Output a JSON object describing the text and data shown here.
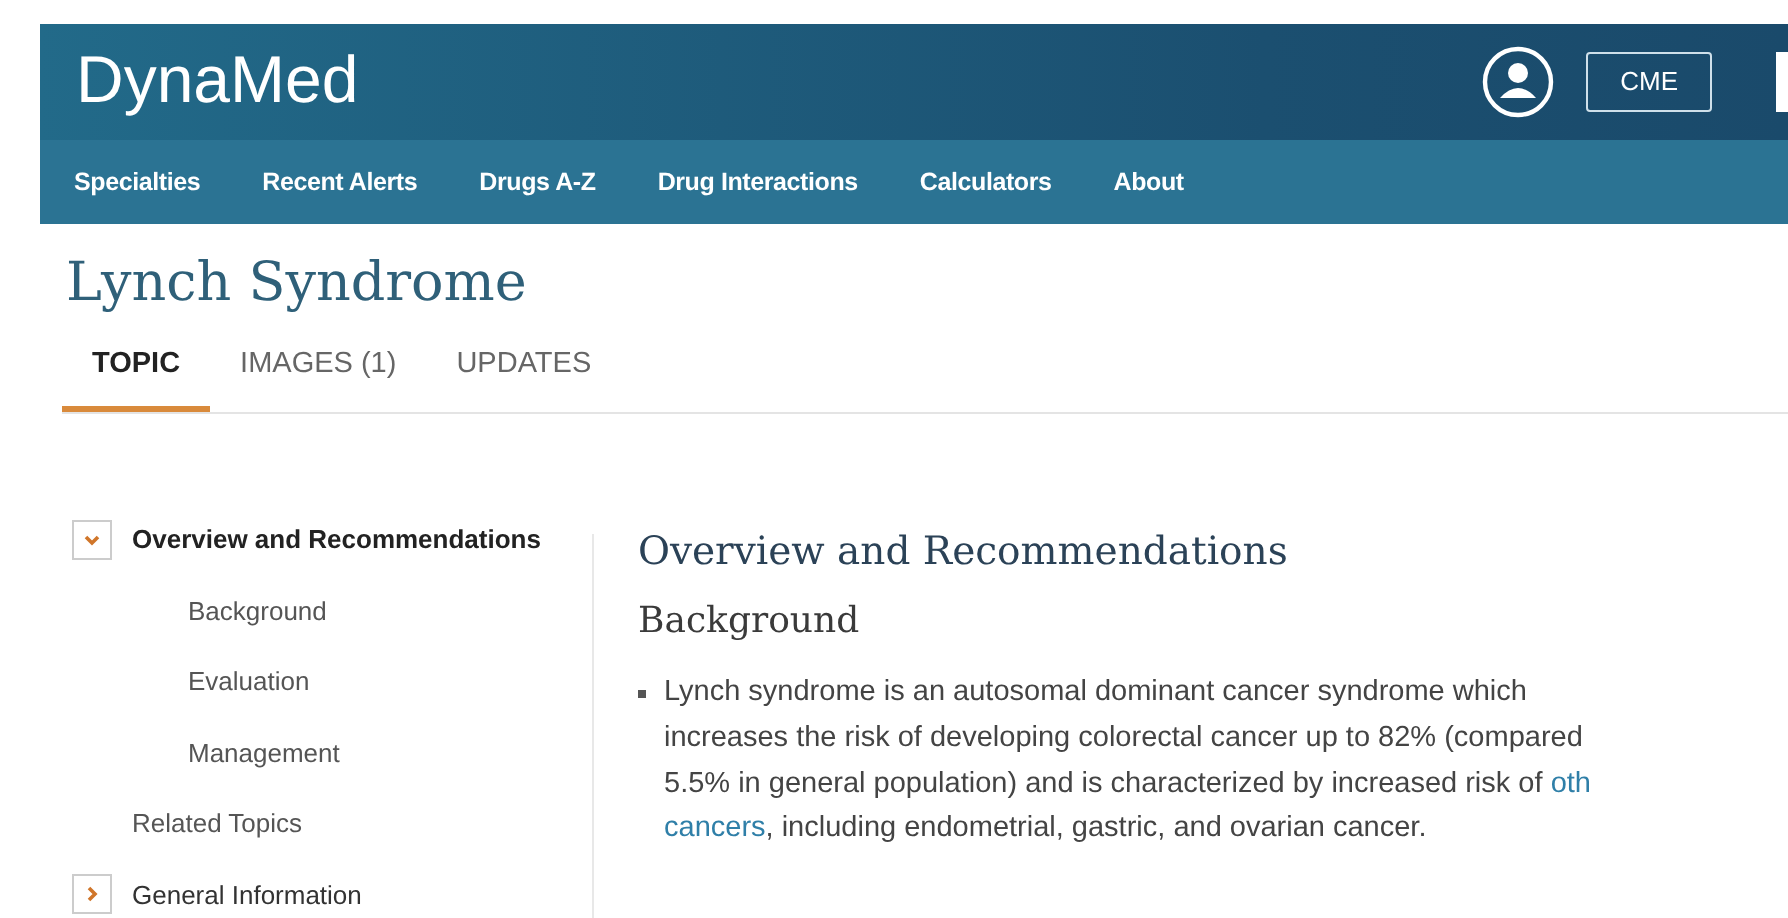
{
  "header": {
    "logo": "DynaMed",
    "cme_button": "CME"
  },
  "nav": [
    "Specialties",
    "Recent Alerts",
    "Drugs A-Z",
    "Drug Interactions",
    "Calculators",
    "About"
  ],
  "title": "Lynch Syndrome",
  "tabs": [
    {
      "label": "TOPIC",
      "selected": true
    },
    {
      "label": "IMAGES (1)",
      "selected": false
    },
    {
      "label": "UPDATES",
      "selected": false
    }
  ],
  "toc": [
    {
      "label": "Overview and Recommendations",
      "kind": "section",
      "expanded": true,
      "children": [
        {
          "label": "Background"
        },
        {
          "label": "Evaluation"
        },
        {
          "label": "Management"
        }
      ]
    },
    {
      "label": "Related Topics",
      "kind": "link"
    },
    {
      "label": "General Information",
      "kind": "section",
      "expanded": false
    }
  ],
  "content": {
    "heading": "Overview and Recommendations",
    "subheading": "Background",
    "bullet_lines": [
      [
        {
          "kind": "text",
          "text": "Lynch syndrome is an autosomal dominant cancer syndrome which"
        }
      ],
      [
        {
          "kind": "text",
          "text": "increases the risk of developing colorectal cancer up to 82% (compared"
        }
      ],
      [
        {
          "kind": "text",
          "text": "5.5% in general population) and is characterized by increased risk of "
        },
        {
          "kind": "link",
          "text": "oth"
        }
      ],
      [
        {
          "kind": "link",
          "text": "cancers"
        },
        {
          "kind": "text",
          "text": ", including endometrial, gastric, and ovarian cancer."
        }
      ]
    ]
  }
}
